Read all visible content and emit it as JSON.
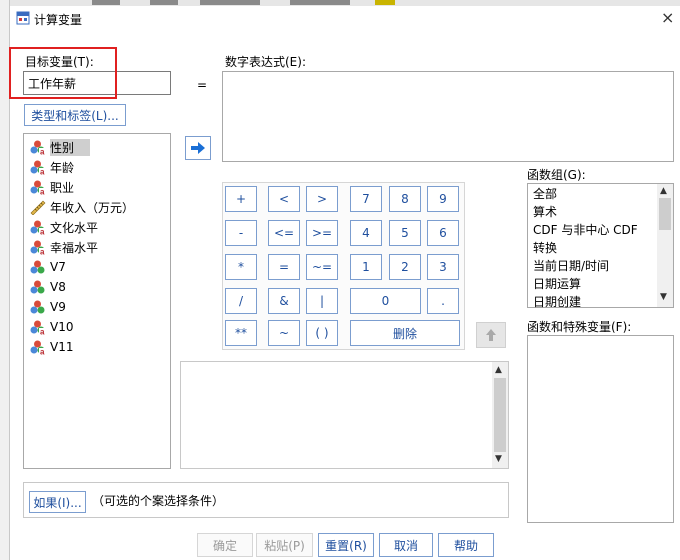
{
  "window": {
    "title": "计算变量",
    "close_glyph": "×"
  },
  "target": {
    "label": "目标变量(T):",
    "value": "工作年薪",
    "equals": "=",
    "type_label_button": "类型和标签(L)..."
  },
  "expression": {
    "label": "数字表达式(E):",
    "value": ""
  },
  "variables": [
    {
      "name": "性别",
      "icon": "nominal-person-icon"
    },
    {
      "name": "年龄",
      "icon": "nominal-person-icon"
    },
    {
      "name": "职业",
      "icon": "nominal-person-icon"
    },
    {
      "name": "年收入（万元）",
      "icon": "ruler-scale-icon"
    },
    {
      "name": "文化水平",
      "icon": "nominal-person-icon"
    },
    {
      "name": "幸福水平",
      "icon": "nominal-person-icon"
    },
    {
      "name": "V7",
      "icon": "ordinal-bars-icon"
    },
    {
      "name": "V8",
      "icon": "ordinal-bars-icon"
    },
    {
      "name": "V9",
      "icon": "ordinal-bars-icon"
    },
    {
      "name": "V10",
      "icon": "nominal-person-icon"
    },
    {
      "name": "V11",
      "icon": "nominal-person-icon"
    }
  ],
  "keypad": {
    "row1": [
      "+",
      "<",
      ">",
      "7",
      "8",
      "9"
    ],
    "row2": [
      "-",
      "<=",
      ">=",
      "4",
      "5",
      "6"
    ],
    "row3": [
      "*",
      "=",
      "~=",
      "1",
      "2",
      "3"
    ],
    "row4": [
      "/",
      "&",
      "|",
      "0",
      "."
    ],
    "row5": [
      "**",
      "~",
      "( )",
      "删除"
    ]
  },
  "function_group": {
    "label": "函数组(G):",
    "items": [
      "全部",
      "算术",
      "CDF 与非中心 CDF",
      "转换",
      "当前日期/时间",
      "日期运算",
      "日期创建"
    ]
  },
  "functions_special": {
    "label": "函数和特殊变量(F):"
  },
  "if_condition": {
    "button": "如果(I)...",
    "text": "（可选的个案选择条件）"
  },
  "footer": {
    "ok": "确定",
    "paste": "粘贴(P)",
    "reset": "重置(R)",
    "cancel": "取消",
    "help": "帮助"
  },
  "colors": {
    "accent_blue": "#1f4f9e",
    "highlight_red": "#e02020",
    "arrow_blue": "#1a6fd6"
  }
}
